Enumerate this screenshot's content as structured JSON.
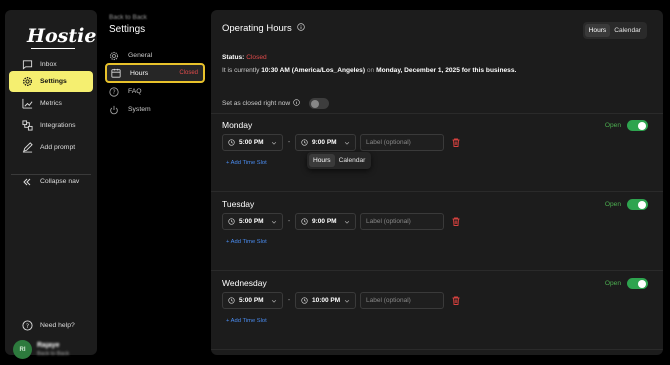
{
  "nav": {
    "logo": "Hostie",
    "items": [
      {
        "label": "Inbox",
        "icon": "inbox-icon"
      },
      {
        "label": "Settings",
        "icon": "gear-icon"
      },
      {
        "label": "Metrics",
        "icon": "chart-icon"
      },
      {
        "label": "Integrations",
        "icon": "integrations-icon"
      },
      {
        "label": "Add prompt",
        "icon": "pencil-icon"
      }
    ],
    "collapse": "Collapse nav",
    "help": "Need help?",
    "user_initials": "RI",
    "user_name": "Rajaye",
    "user_org": "Back to Back"
  },
  "settings": {
    "back": "Back to Back",
    "title": "Settings",
    "items": [
      {
        "label": "General",
        "icon": "gear-icon"
      },
      {
        "label": "Hours",
        "icon": "calendar-icon",
        "tag": "Closed"
      },
      {
        "label": "FAQ",
        "icon": "question-icon"
      },
      {
        "label": "System",
        "icon": "power-icon"
      }
    ]
  },
  "main": {
    "title": "Operating Hours",
    "view_tabs": [
      "Hours",
      "Calendar"
    ],
    "status_label": "Status:",
    "status_value": "Closed",
    "status_prefix": "It is currently",
    "status_time": "10:30 AM (America/Los_Angeles)",
    "status_on": "on",
    "status_date": "Monday, December 1, 2025",
    "status_suffix": "for this business.",
    "closed_now_label": "Set as closed right now",
    "label_placeholder": "Label (optional)",
    "add_slot": "+ Add Time Slot",
    "open_label": "Open",
    "days": [
      {
        "name": "Monday",
        "start": "5:00 PM",
        "end": "9:00 PM"
      },
      {
        "name": "Tuesday",
        "start": "5:00 PM",
        "end": "9:00 PM"
      },
      {
        "name": "Wednesday",
        "start": "5:00 PM",
        "end": "10:00 PM"
      }
    ],
    "popover_tabs": [
      "Hours",
      "Calendar"
    ]
  }
}
